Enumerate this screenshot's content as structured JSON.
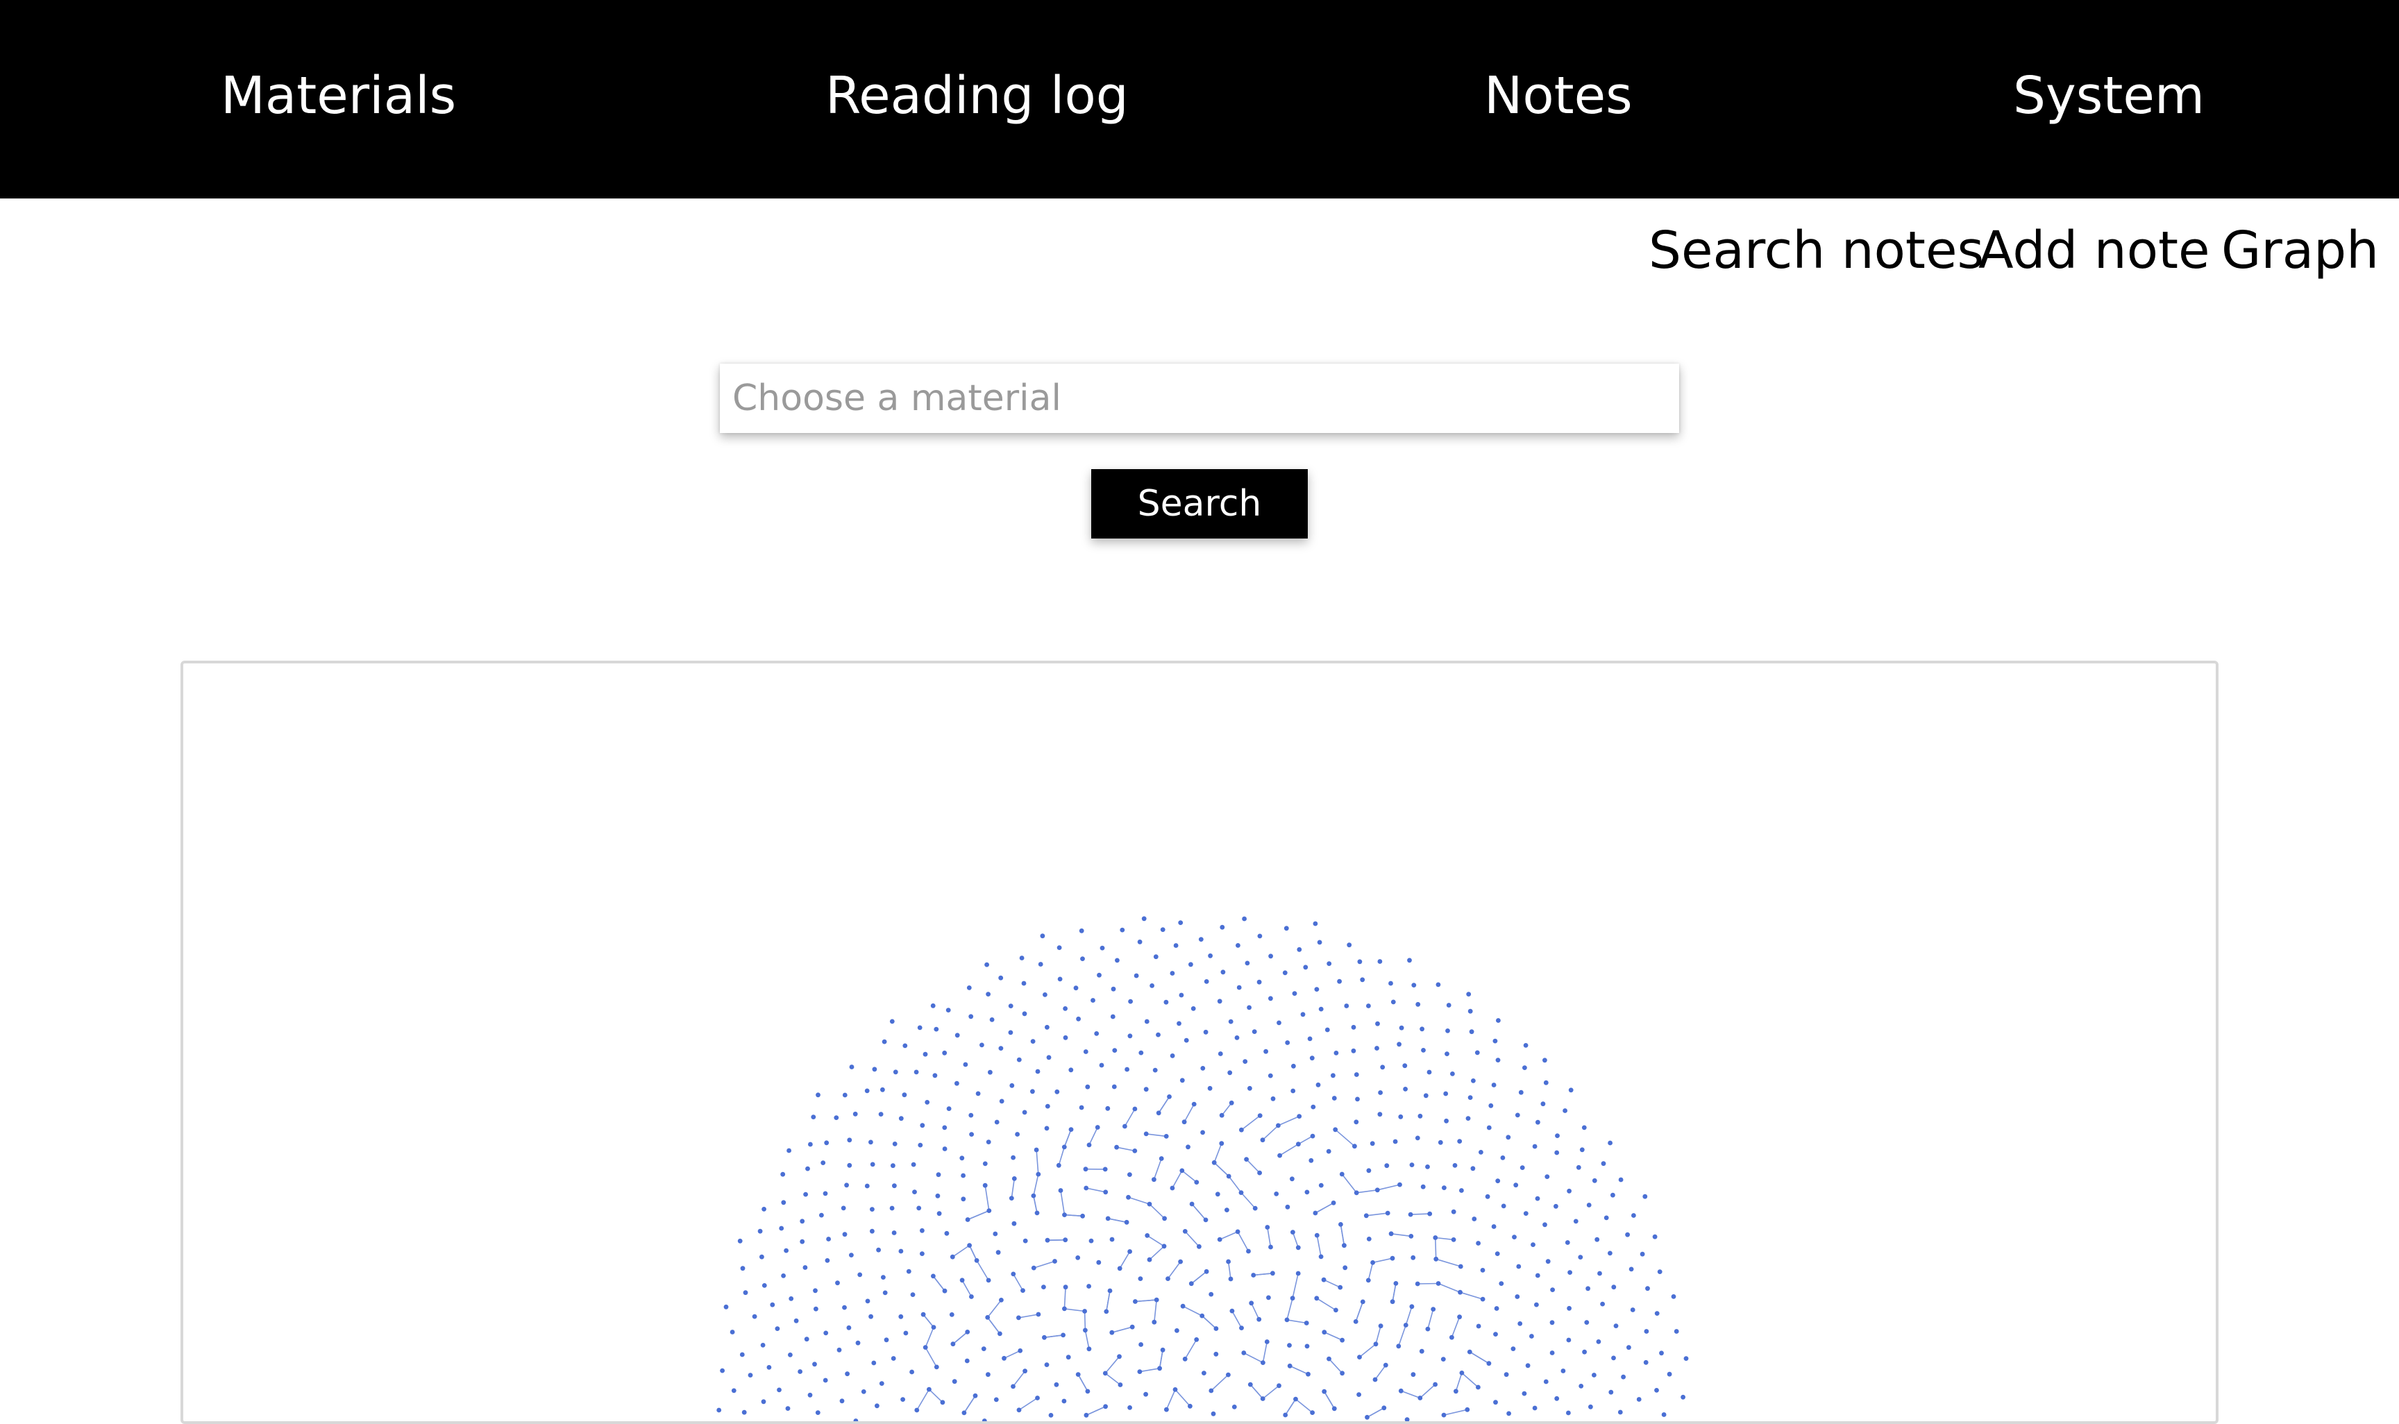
{
  "topnav": {
    "items": [
      {
        "label": "Materials"
      },
      {
        "label": "Reading log"
      },
      {
        "label": "Notes"
      },
      {
        "label": "System"
      }
    ]
  },
  "subnav": {
    "items": [
      {
        "label": "Search notes"
      },
      {
        "label": "Add note"
      },
      {
        "label": "Graph"
      }
    ]
  },
  "search": {
    "placeholder": "Choose a material",
    "value": "",
    "button_label": "Search"
  },
  "graph": {
    "node_color": "#4a6fd4",
    "edge_color": "#7a95dd"
  }
}
